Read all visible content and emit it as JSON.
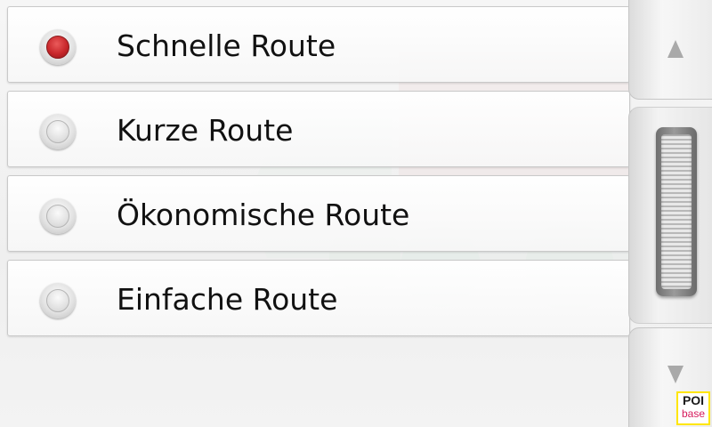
{
  "route_options": [
    {
      "label": "Schnelle Route",
      "selected": true
    },
    {
      "label": "Kurze Route",
      "selected": false
    },
    {
      "label": "Ökonomische Route",
      "selected": false
    },
    {
      "label": "Einfache Route",
      "selected": false
    }
  ],
  "scroll": {
    "up_icon": "chevron-up-icon",
    "down_icon": "chevron-down-icon"
  },
  "logo": {
    "line1": "POI",
    "line2": "base"
  },
  "colors": {
    "selected_radio": "#c8272b",
    "logo_frame": "#ffe600",
    "logo_base_text": "#d61a5c"
  }
}
